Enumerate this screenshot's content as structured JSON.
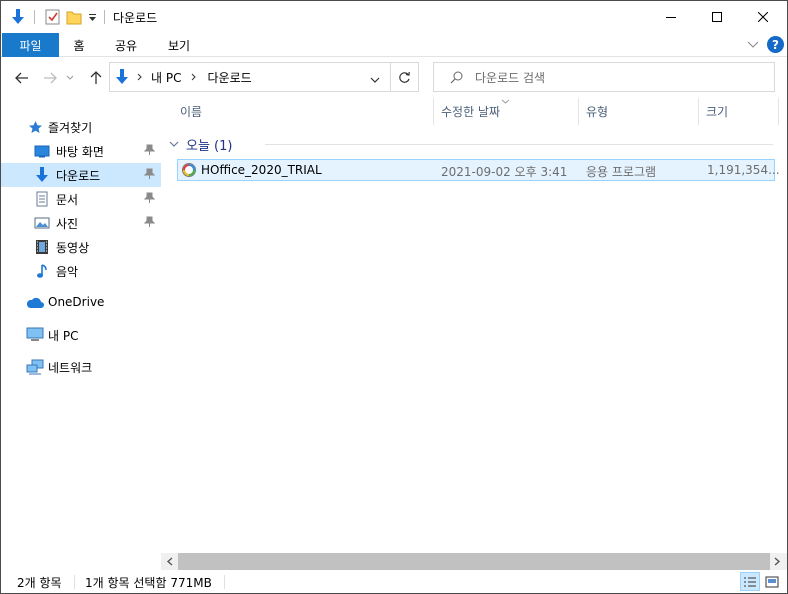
{
  "window": {
    "title": "다운로드"
  },
  "ribbon": {
    "tabs": [
      "파일",
      "홈",
      "공유",
      "보기"
    ],
    "help": "?"
  },
  "address": {
    "segments": [
      "내 PC",
      "다운로드"
    ]
  },
  "search": {
    "placeholder": "다운로드 검색"
  },
  "nav_pane": {
    "quick_access": "즐겨찾기",
    "items": [
      "바탕 화면",
      "다운로드",
      "문서",
      "사진",
      "동영상",
      "음악"
    ],
    "onedrive": "OneDrive",
    "this_pc": "내 PC",
    "network": "네트워크"
  },
  "columns": [
    "이름",
    "수정한 날짜",
    "유형",
    "크기"
  ],
  "group": {
    "label": "오늘 (1)"
  },
  "files": [
    {
      "name": "HOffice_2020_TRIAL",
      "modified": "2021-09-02 오후 3:41",
      "type": "응용 프로그램",
      "size": "1,191,354..."
    }
  ],
  "status": {
    "count": "2개 항목",
    "selection": "1개 항목 선택함 771MB"
  },
  "colors": {
    "accent": "#1979ca",
    "selection": "#cce8ff",
    "row_border": "#99d1ff",
    "group_text": "#1e3287"
  }
}
